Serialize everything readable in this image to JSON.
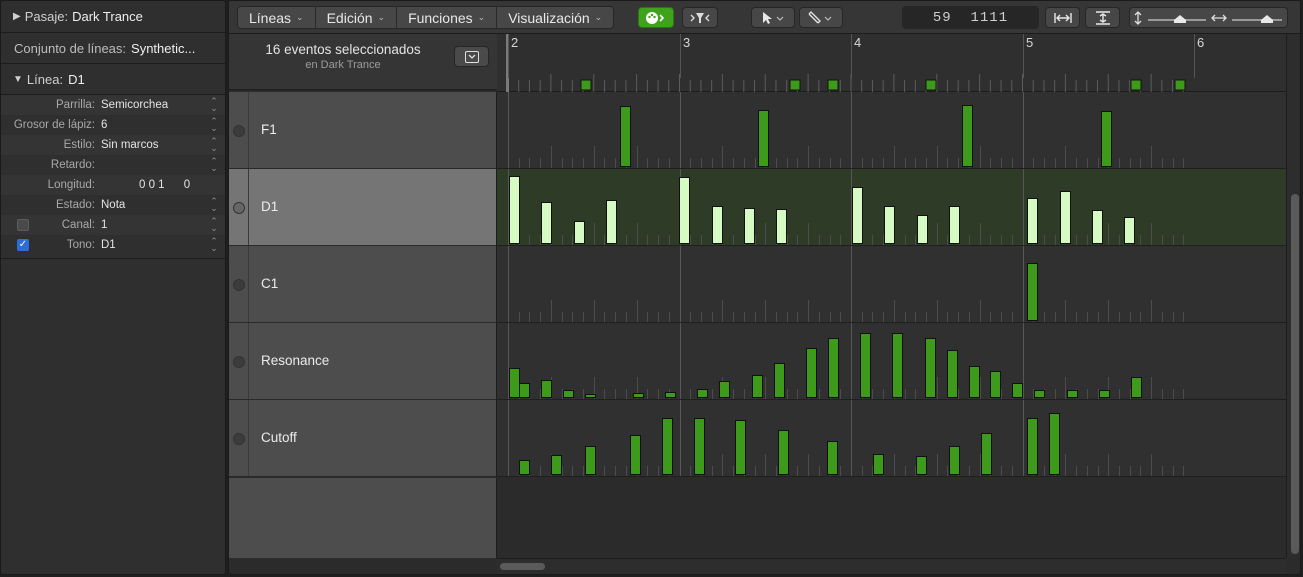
{
  "inspector": {
    "region_label": "Pasaje:",
    "region_name": "Dark Trance",
    "lineset_label": "Conjunto de líneas:",
    "lineset_name": "Synthetic...",
    "lane_label": "Línea:",
    "lane_name": "D1",
    "params": [
      {
        "label": "Parrilla:",
        "value": "Semicorchea"
      },
      {
        "label": "Grosor de lápiz:",
        "value": "6"
      },
      {
        "label": "Estilo:",
        "value": "Sin marcos"
      },
      {
        "label": "Retardo:",
        "value": ""
      },
      {
        "label": "Longitud:",
        "value": "0 0 1      0"
      },
      {
        "label": "Estado:",
        "value": "Nota"
      },
      {
        "label": "Canal:",
        "value": "1"
      },
      {
        "label": "Tono:",
        "value": "D1"
      }
    ]
  },
  "toolbar": {
    "menus": [
      "Líneas",
      "Edición",
      "Funciones",
      "Visualización"
    ],
    "position_display": "59  1111"
  },
  "header": {
    "selection_count": "16 eventos seleccionados",
    "selection_region": "en Dark Trance"
  },
  "ruler": {
    "bars": [
      "2",
      "3",
      "4",
      "5",
      "6"
    ]
  },
  "lanes": [
    {
      "name": "F1",
      "selected": false,
      "events": [
        [
          0.156,
          0.8
        ],
        [
          0.331,
          0.75
        ],
        [
          0.589,
          0.82
        ],
        [
          0.766,
          0.74
        ]
      ]
    },
    {
      "name": "D1",
      "selected": true,
      "events": [
        [
          0.015,
          0.9
        ],
        [
          0.056,
          0.55
        ],
        [
          0.097,
          0.3
        ],
        [
          0.138,
          0.58
        ],
        [
          0.231,
          0.88
        ],
        [
          0.272,
          0.5
        ],
        [
          0.313,
          0.48
        ],
        [
          0.354,
          0.46
        ],
        [
          0.45,
          0.75
        ],
        [
          0.491,
          0.5
        ],
        [
          0.532,
          0.38
        ],
        [
          0.573,
          0.5
        ],
        [
          0.672,
          0.6
        ],
        [
          0.713,
          0.7
        ],
        [
          0.754,
          0.45
        ],
        [
          0.795,
          0.36
        ]
      ]
    },
    {
      "name": "C1",
      "selected": false,
      "events": [
        [
          0.672,
          0.76
        ]
      ]
    },
    {
      "name": "Resonance",
      "selected": false,
      "events": [
        [
          0.015,
          0.4
        ],
        [
          0.028,
          0.2
        ],
        [
          0.056,
          0.24
        ],
        [
          0.084,
          0.1
        ],
        [
          0.111,
          0.04
        ],
        [
          0.172,
          0.06
        ],
        [
          0.213,
          0.08
        ],
        [
          0.254,
          0.12
        ],
        [
          0.282,
          0.22
        ],
        [
          0.323,
          0.3
        ],
        [
          0.351,
          0.46
        ],
        [
          0.392,
          0.66
        ],
        [
          0.419,
          0.79
        ],
        [
          0.46,
          0.85
        ],
        [
          0.501,
          0.85
        ],
        [
          0.542,
          0.79
        ],
        [
          0.57,
          0.63
        ],
        [
          0.598,
          0.42
        ],
        [
          0.625,
          0.35
        ],
        [
          0.653,
          0.2
        ],
        [
          0.681,
          0.1
        ],
        [
          0.722,
          0.1
        ],
        [
          0.763,
          0.1
        ],
        [
          0.804,
          0.27
        ]
      ]
    },
    {
      "name": "Cutoff",
      "selected": false,
      "events": [
        [
          0.028,
          0.2
        ],
        [
          0.069,
          0.26
        ],
        [
          0.111,
          0.38
        ],
        [
          0.168,
          0.53
        ],
        [
          0.209,
          0.75
        ],
        [
          0.25,
          0.75
        ],
        [
          0.302,
          0.73
        ],
        [
          0.356,
          0.59
        ],
        [
          0.418,
          0.45
        ],
        [
          0.477,
          0.27
        ],
        [
          0.531,
          0.25
        ],
        [
          0.573,
          0.38
        ],
        [
          0.614,
          0.55
        ],
        [
          0.672,
          0.75
        ],
        [
          0.699,
          0.82
        ]
      ]
    }
  ]
}
